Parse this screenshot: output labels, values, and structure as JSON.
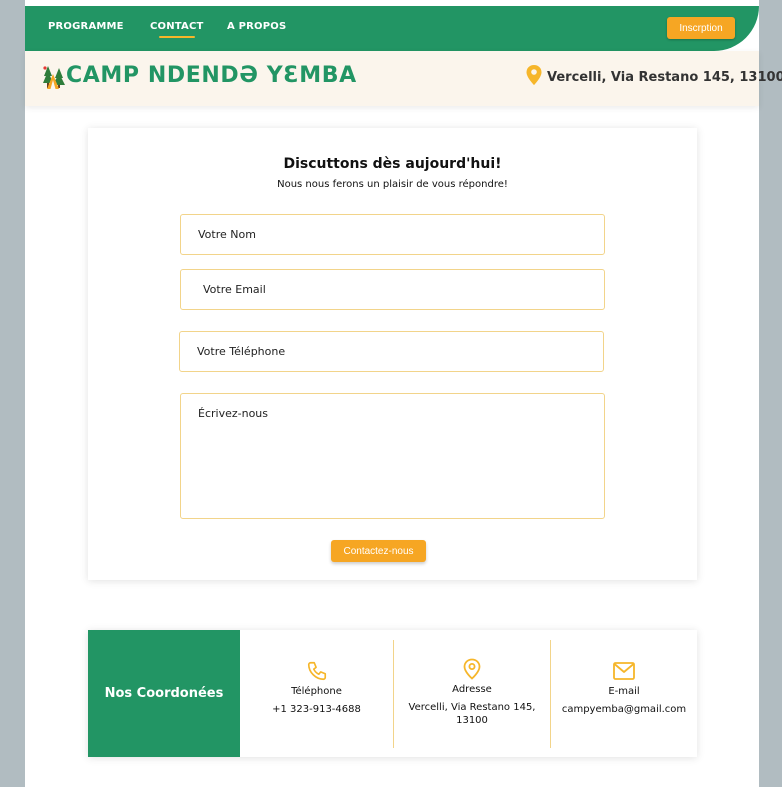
{
  "nav": {
    "items": [
      {
        "label": "PROGRAMME"
      },
      {
        "label": "CONTACT"
      },
      {
        "label": "A PROPOS"
      }
    ],
    "cta_label": "Inscrption"
  },
  "brand": {
    "title": "CAMP NDENDƏ YƐMBA",
    "address": "Vercelli, Via Restano 145, 13100"
  },
  "form": {
    "title": "Discuttons dès aujourd'hui!",
    "subtitle": "Nous nous ferons un plaisir de vous répondre!",
    "name_placeholder": "Votre Nom",
    "email_placeholder": "Votre Email",
    "phone_placeholder": "Votre Téléphone",
    "message_placeholder": "Écrivez-nous",
    "submit_label": "Contactez-nous"
  },
  "coordinates": {
    "heading": "Nos Coordonées",
    "phone_label": "Téléphone",
    "phone_value": "+1 323-913-4688",
    "address_label": "Adresse",
    "address_line1": "Vercelli, Via Restano 145,",
    "address_line2": "13100",
    "email_label": "E-mail",
    "email_value": "campyemba@gmail.com"
  },
  "colors": {
    "brand_green": "#229564",
    "accent_orange": "#f6a623",
    "accent_yellow": "#f6b62a",
    "field_border": "#f2d48a",
    "brand_bar_bg": "#fbf5ec",
    "outer_bg": "#b1bcc1"
  },
  "icons": {
    "logo": "camp-tent-trees-icon",
    "address_pin": "map-pin-icon",
    "phone": "phone-icon",
    "location": "location-pin-icon",
    "email": "envelope-icon"
  }
}
